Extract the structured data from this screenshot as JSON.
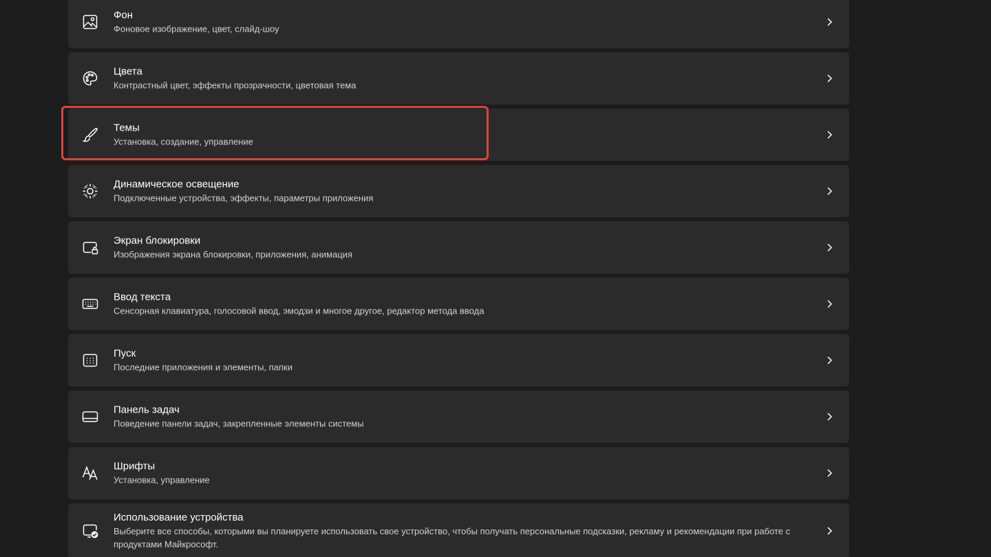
{
  "settings": {
    "items": [
      {
        "title": "Фон",
        "subtitle": "Фоновое изображение, цвет, слайд-шоу",
        "icon": "image-icon"
      },
      {
        "title": "Цвета",
        "subtitle": "Контрастный цвет, эффекты прозрачности, цветовая тема",
        "icon": "palette-icon"
      },
      {
        "title": "Темы",
        "subtitle": "Установка, создание, управление",
        "icon": "brush-icon"
      },
      {
        "title": "Динамическое освещение",
        "subtitle": "Подключенные устройства, эффекты, параметры приложения",
        "icon": "lighting-icon"
      },
      {
        "title": "Экран блокировки",
        "subtitle": "Изображения экрана блокировки, приложения, анимация",
        "icon": "lock-screen-icon"
      },
      {
        "title": "Ввод текста",
        "subtitle": "Сенсорная клавиатура, голосовой ввод, эмодзи и многое другое, редактор метода ввода",
        "icon": "keyboard-icon"
      },
      {
        "title": "Пуск",
        "subtitle": "Последние приложения и элементы, папки",
        "icon": "start-icon"
      },
      {
        "title": "Панель задач",
        "subtitle": "Поведение панели задач, закрепленные элементы системы",
        "icon": "taskbar-icon"
      },
      {
        "title": "Шрифты",
        "subtitle": "Установка, управление",
        "icon": "fonts-icon"
      },
      {
        "title": "Использование устройства",
        "subtitle": "Выберите все способы, которыми вы планируете использовать свое устройство, чтобы получать персональные подсказки, рекламу и рекомендации при работе с продуктами Майкрософт.",
        "icon": "device-usage-icon"
      }
    ]
  },
  "colors": {
    "background": "#1c1c1c",
    "card": "#2b2b2b",
    "highlight": "#d9453e"
  }
}
